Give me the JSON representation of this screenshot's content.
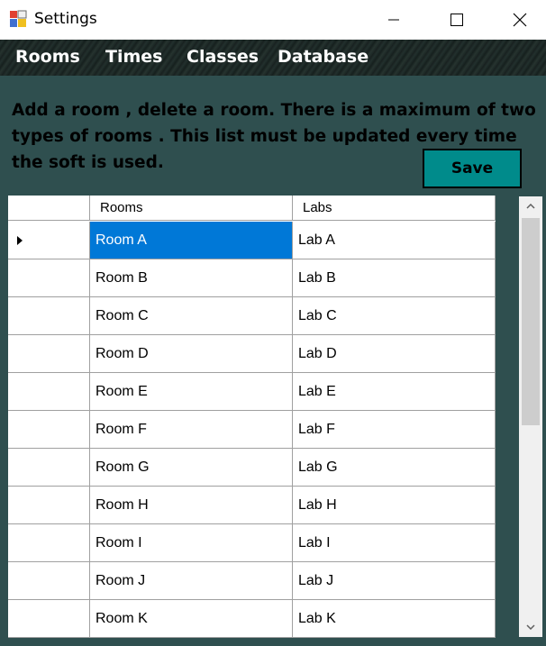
{
  "window": {
    "title": "Settings"
  },
  "menu": {
    "items": [
      "Rooms",
      "Times",
      "Classes",
      "Database"
    ]
  },
  "instructions": "Add a room , delete a room. There is a maximum of two types of rooms . This list must be updated every time the soft is used.",
  "save_label": "Save",
  "grid": {
    "columns": [
      "Rooms",
      "Labs"
    ],
    "rows": [
      [
        "Room A",
        "Lab A"
      ],
      [
        "Room B",
        "Lab B"
      ],
      [
        "Room C",
        "Lab C"
      ],
      [
        "Room D",
        "Lab D"
      ],
      [
        "Room E",
        "Lab E"
      ],
      [
        "Room F",
        "Lab F"
      ],
      [
        "Room G",
        "Lab G"
      ],
      [
        "Room H",
        "Lab H"
      ],
      [
        "Room I",
        "Lab I"
      ],
      [
        "Room J",
        "Lab J"
      ],
      [
        "Room K",
        "Lab K"
      ]
    ],
    "selected_row": 0,
    "selected_column": 0
  },
  "colors": {
    "background": "#2f4f4f",
    "save_button": "#008b8b",
    "selection": "#0078d7"
  },
  "icons": {
    "app": "app-icon",
    "minimize": "minimize-icon",
    "maximize": "maximize-icon",
    "close": "close-icon",
    "row_indicator": "row-pointer-icon",
    "scroll_up": "chevron-up-icon",
    "scroll_down": "chevron-down-icon"
  }
}
